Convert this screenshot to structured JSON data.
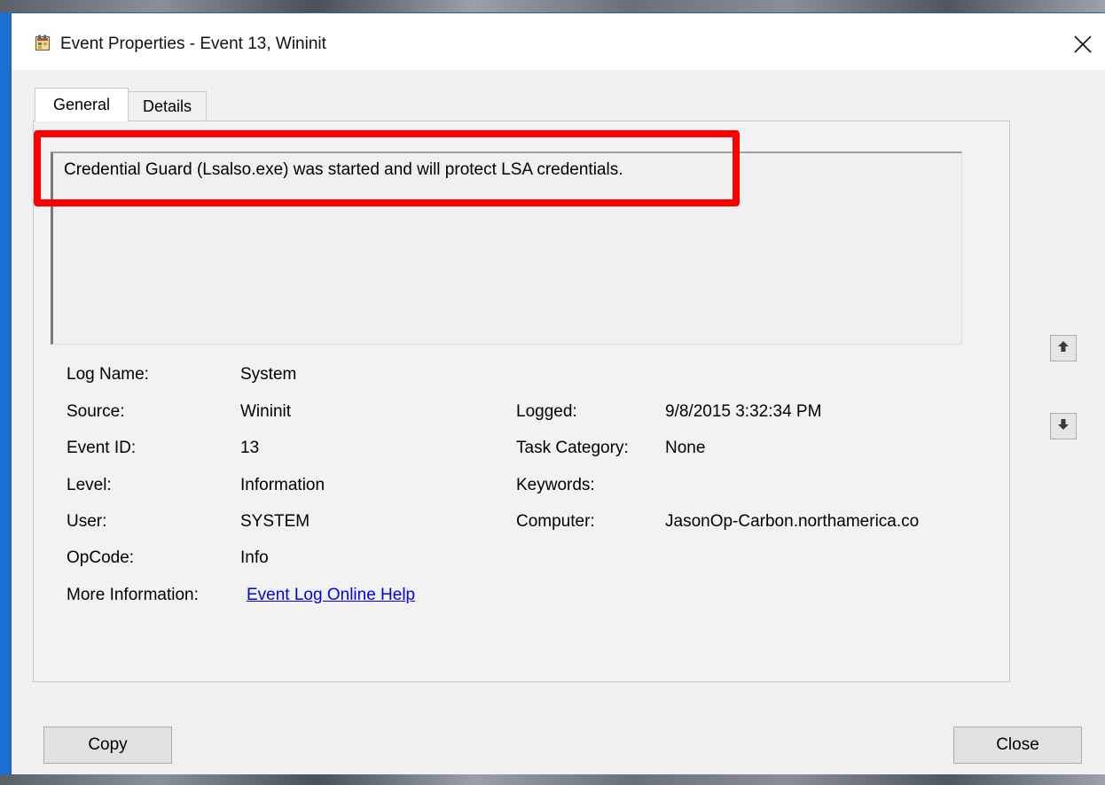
{
  "window": {
    "title": "Event Properties - Event 13, Wininit",
    "icon": "event-properties-icon",
    "close_icon": "close-icon"
  },
  "tabs": [
    {
      "label": "General",
      "selected": true
    },
    {
      "label": "Details",
      "selected": false
    }
  ],
  "description": "Credential Guard (Lsalso.exe) was started and will protect LSA credentials.",
  "highlight_color": "#ff0000",
  "fields_left": [
    {
      "label": "Log Name:",
      "value": "System"
    },
    {
      "label": "Source:",
      "value": "Wininit"
    },
    {
      "label": "Event ID:",
      "value": "13"
    },
    {
      "label": "Level:",
      "value": "Information"
    },
    {
      "label": "User:",
      "value": "SYSTEM"
    },
    {
      "label": "OpCode:",
      "value": "Info"
    },
    {
      "label": "More Information:",
      "value": "Event Log Online Help"
    }
  ],
  "fields_right": [
    {
      "label": "Logged:",
      "value": "9/8/2015 3:32:34 PM"
    },
    {
      "label": "Task Category:",
      "value": "None"
    },
    {
      "label": "Keywords:",
      "value": ""
    },
    {
      "label": "Computer:",
      "value": "JasonOp-Carbon.northamerica.co"
    }
  ],
  "nav": {
    "up_icon": "arrow-up-icon",
    "down_icon": "arrow-down-icon"
  },
  "buttons": {
    "copy": "Copy",
    "close": "Close"
  }
}
